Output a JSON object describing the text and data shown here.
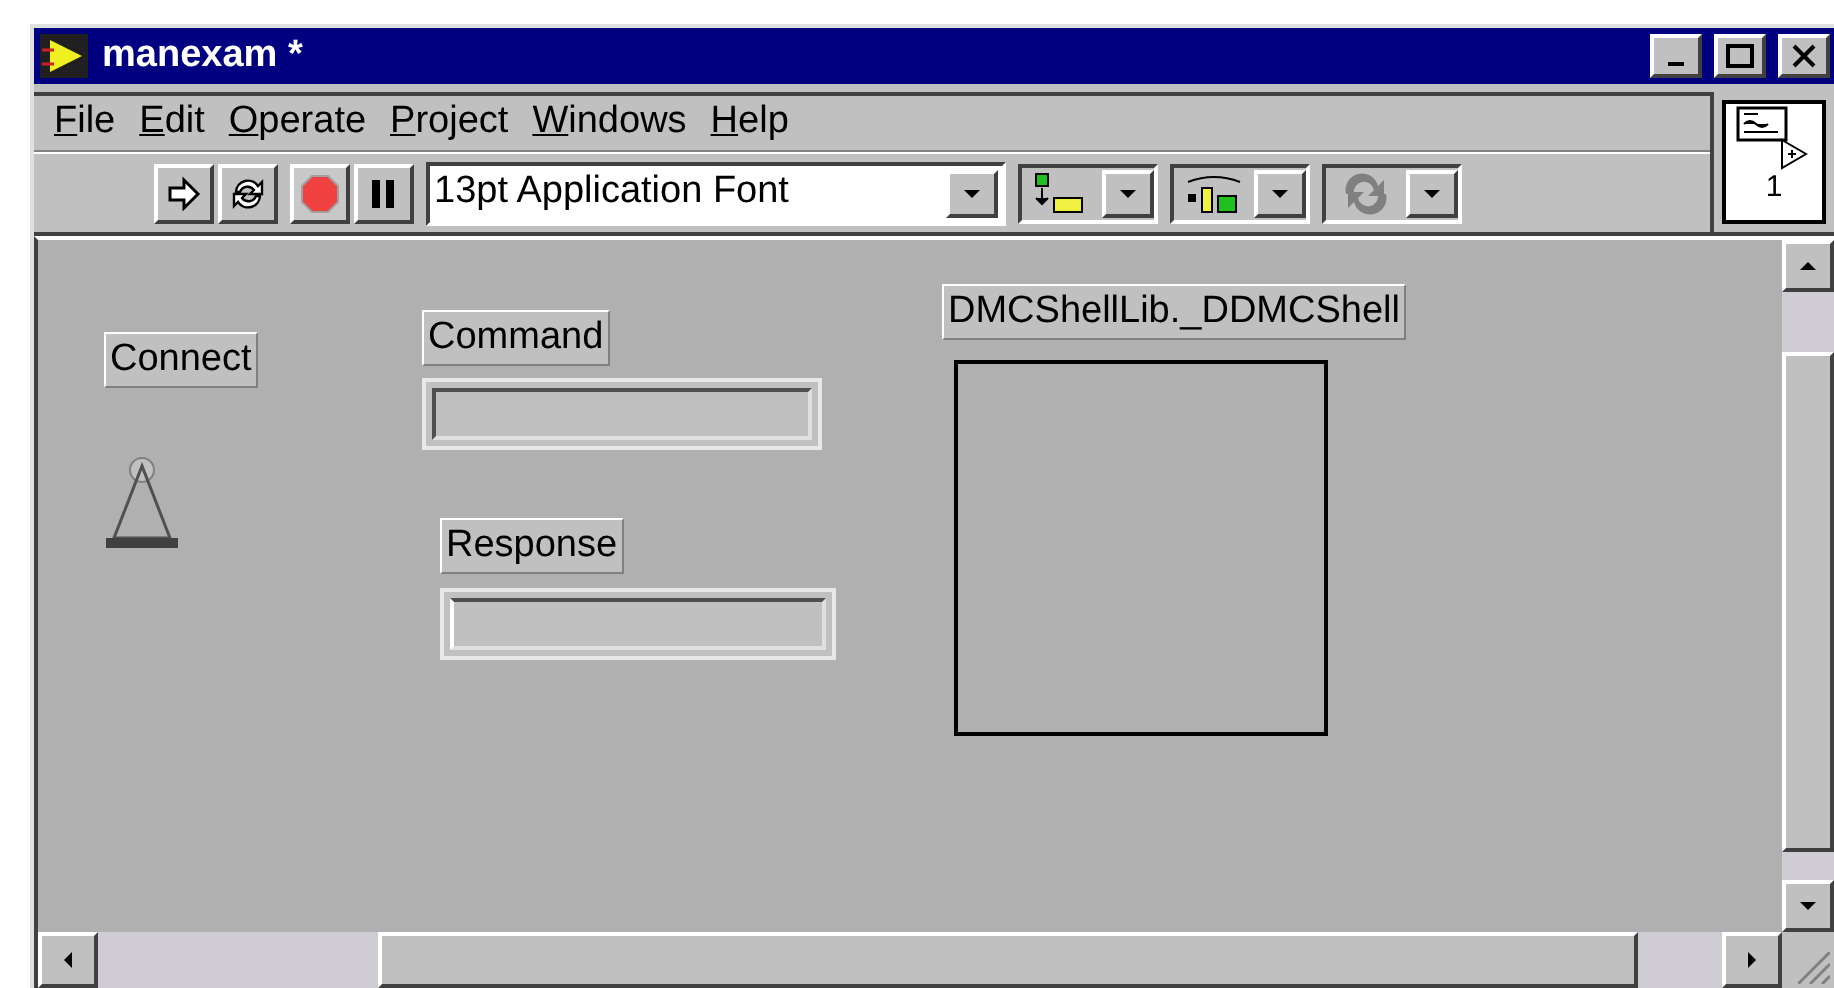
{
  "window": {
    "title": "manexam *"
  },
  "menu": [
    "File",
    "Edit",
    "Operate",
    "Project",
    "Windows",
    "Help"
  ],
  "toolbar": {
    "font": "13pt Application Font"
  },
  "icon_pane": {
    "connector_label": "1"
  },
  "panel": {
    "controls": [
      {
        "kind": "switch",
        "label": "Connect",
        "on": false
      },
      {
        "kind": "string",
        "label": "Command"
      },
      {
        "kind": "string",
        "label": "Response"
      },
      {
        "kind": "container",
        "label": "DMCShellLib._DDMCShell"
      }
    ]
  }
}
